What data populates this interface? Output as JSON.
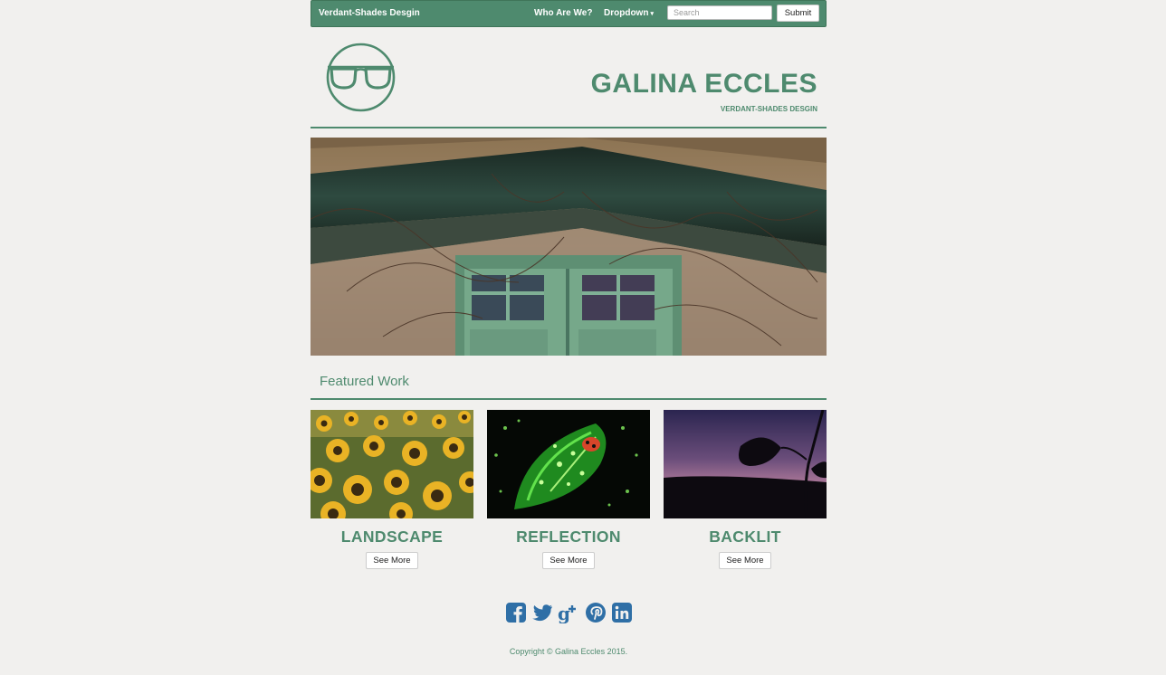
{
  "navbar": {
    "brand": "Verdant-Shades Desgin",
    "links": [
      {
        "label": "Who Are We?"
      },
      {
        "label": "Dropdown",
        "caret": "▾"
      }
    ],
    "search": {
      "placeholder": "Search",
      "value": ""
    },
    "submit_label": "Submit"
  },
  "header": {
    "title": "GALINA ECCLES",
    "subtitle": "VERDANT-SHADES DESGIN",
    "logo_icon": "glasses-icon"
  },
  "hero": {
    "image_icon": "hero-photo-green-door"
  },
  "featured": {
    "heading": "Featured Work"
  },
  "cards": [
    {
      "title": "LANDSCAPE",
      "button": "See More",
      "image_icon": "sunflowers-photo"
    },
    {
      "title": "REFLECTION",
      "button": "See More",
      "image_icon": "dewdrop-leaf-photo"
    },
    {
      "title": "BACKLIT",
      "button": "See More",
      "image_icon": "leaf-silhouette-photo"
    }
  ],
  "social": [
    {
      "name": "facebook-icon"
    },
    {
      "name": "twitter-icon"
    },
    {
      "name": "google-plus-icon"
    },
    {
      "name": "pinterest-icon"
    },
    {
      "name": "linkedin-icon"
    }
  ],
  "footer": {
    "copyright": "Copyright © Galina Eccles 2015."
  },
  "colors": {
    "accent": "#4e8a6e",
    "social": "#2f6fa6",
    "background": "#f1f0ee"
  }
}
